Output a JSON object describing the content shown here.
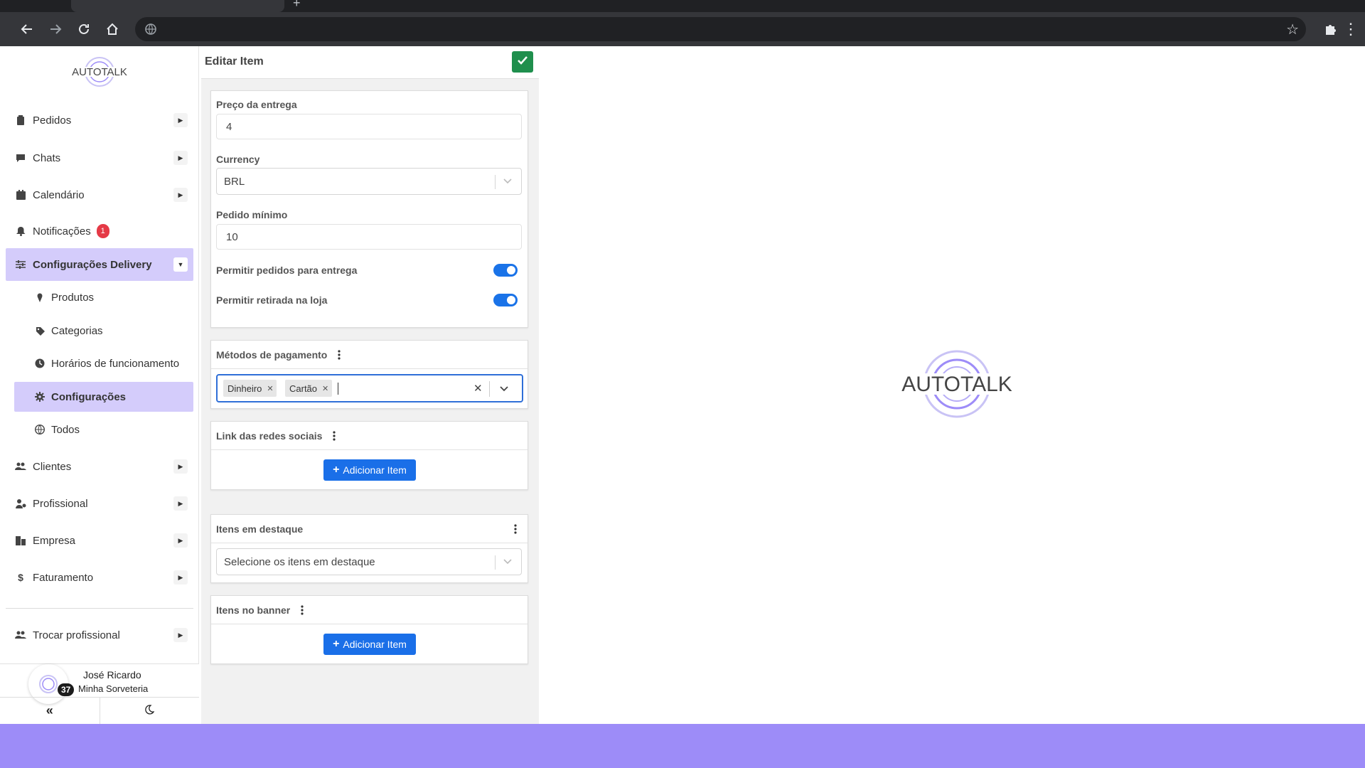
{
  "browser": {
    "back_icon": "arrow-left-icon",
    "forward_icon": "arrow-right-icon",
    "reload_icon": "reload-icon",
    "home_icon": "home-icon"
  },
  "sidebar": {
    "logo_text": "AUTOTALK",
    "items": [
      {
        "label": "Pedidos",
        "icon": "clipboard-icon"
      },
      {
        "label": "Chats",
        "icon": "chat-icon"
      },
      {
        "label": "Calendário",
        "icon": "calendar-icon"
      },
      {
        "label": "Notificações",
        "icon": "bell-icon",
        "badge": "1"
      },
      {
        "label": "Configurações Delivery",
        "icon": "sliders-icon"
      },
      {
        "label": "Clientes",
        "icon": "users-icon"
      },
      {
        "label": "Profissional",
        "icon": "user-cog-icon"
      },
      {
        "label": "Empresa",
        "icon": "building-icon"
      },
      {
        "label": "Faturamento",
        "icon": "dollar-icon"
      },
      {
        "label": "Trocar profissional",
        "icon": "users-swap-icon"
      }
    ],
    "subitems": [
      {
        "label": "Produtos",
        "icon": "ice-cream-icon"
      },
      {
        "label": "Categorias",
        "icon": "tag-icon"
      },
      {
        "label": "Horários de funcionamento",
        "icon": "clock-icon"
      },
      {
        "label": "Configurações",
        "icon": "gear-icon"
      },
      {
        "label": "Todos",
        "icon": "globe-icon"
      }
    ],
    "user": {
      "name": "José Ricardo",
      "company": "Minha Sorveteria",
      "count": "37"
    }
  },
  "edit": {
    "title": "Editar Item",
    "delivery_price_label": "Preço da entrega",
    "delivery_price_value": "4",
    "currency_label": "Currency",
    "currency_value": "BRL",
    "min_order_label": "Pedido mínimo",
    "min_order_value": "10",
    "allow_delivery_label": "Permitir pedidos para entrega",
    "allow_delivery_on": true,
    "allow_pickup_label": "Permitir retirada na loja",
    "allow_pickup_on": true,
    "payment_methods_label": "Métodos de pagamento",
    "payment_methods": [
      "Dinheiro",
      "Cartão"
    ],
    "social_links_label": "Link das redes sociais",
    "add_item_label": "Adicionar Item",
    "featured_label": "Itens em destaque",
    "featured_placeholder": "Selecione os itens em destaque",
    "banner_label": "Itens no banner"
  },
  "right": {
    "logo_text": "AUTOTALK"
  },
  "colors": {
    "accent": "#1a6fe8",
    "active_bg": "#d4ccfb",
    "confirm": "#1f8f4d",
    "badge": "#e53946",
    "band": "#9d8cf8"
  }
}
